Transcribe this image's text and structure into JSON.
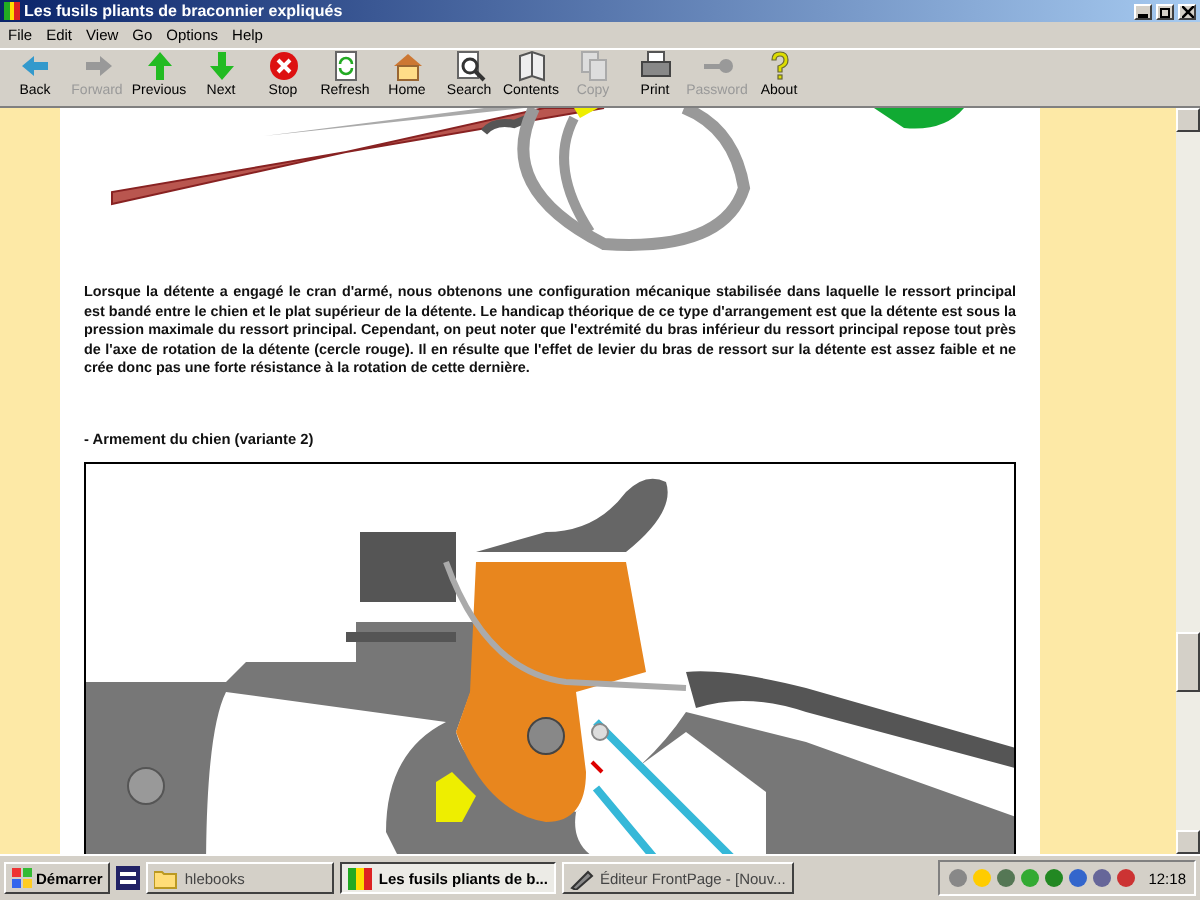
{
  "window": {
    "title": "Les fusils pliants de braconnier expliqués"
  },
  "menu": [
    "File",
    "Edit",
    "View",
    "Go",
    "Options",
    "Help"
  ],
  "toolbar": [
    {
      "kind": "back",
      "label": "Back",
      "disabled": false
    },
    {
      "kind": "forward",
      "label": "Forward",
      "disabled": true
    },
    {
      "kind": "up",
      "label": "Previous",
      "disabled": false
    },
    {
      "kind": "down",
      "label": "Next",
      "disabled": false
    },
    {
      "kind": "stop",
      "label": "Stop",
      "disabled": false
    },
    {
      "kind": "refresh",
      "label": "Refresh",
      "disabled": false
    },
    {
      "kind": "home",
      "label": "Home",
      "disabled": false
    },
    {
      "kind": "search",
      "label": "Search",
      "disabled": false
    },
    {
      "kind": "contents",
      "label": "Contents",
      "disabled": false
    },
    {
      "kind": "copy",
      "label": "Copy",
      "disabled": true
    },
    {
      "kind": "print",
      "label": "Print",
      "disabled": false
    },
    {
      "kind": "key",
      "label": "Password",
      "disabled": true
    },
    {
      "kind": "about",
      "label": "About",
      "disabled": false
    }
  ],
  "page": {
    "paragraph": "Lorsque la détente a engagé le cran d'armé, nous obtenons une configuration mécanique stabilisée dans laquelle le ressort principal est bandé entre le chien et le plat supérieur de la détente. Le handicap théorique de ce type d'arrangement est que la détente est sous la pression maximale du ressort principal. Cependant, on peut noter que l'extrémité du bras inférieur du ressort principal repose tout près de l'axe de rotation de la détente (cercle rouge). Il en résulte que l'effet de levier du bras de ressort sur la détente est assez faible et ne crée donc pas une forte résistance à la rotation de cette dernière.",
    "heading": "- Armement du chien (variante 2)"
  },
  "taskbar": {
    "start": "Démarrer",
    "tasks": [
      {
        "kind": "folder",
        "label": "hlebooks",
        "selected": false
      },
      {
        "kind": "help",
        "label": "Les fusils pliants de b...",
        "selected": true
      },
      {
        "kind": "editor",
        "label": "Éditeur FrontPage - [Nouv...",
        "selected": false
      }
    ],
    "clock": "12:18"
  }
}
